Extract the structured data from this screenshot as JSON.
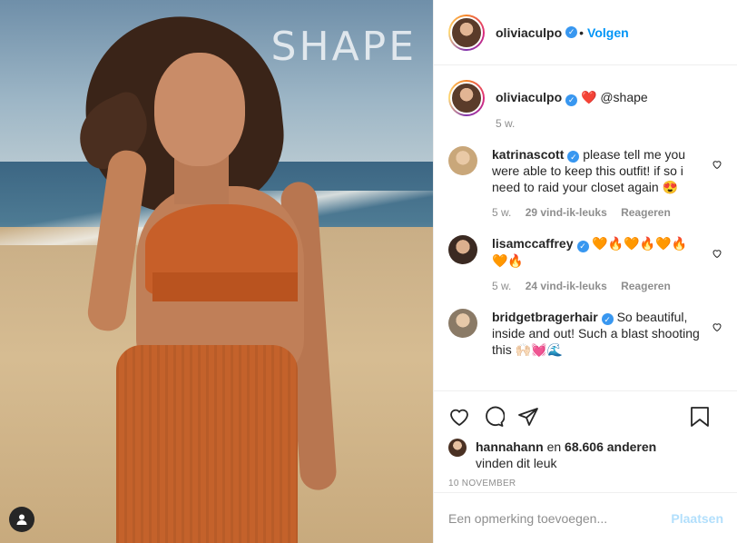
{
  "photo": {
    "overlay_text": "SHAPE"
  },
  "header": {
    "username": "oliviaculpo",
    "separator": "•",
    "follow_label": "Volgen",
    "more_label": "···"
  },
  "caption": {
    "username": "oliviaculpo",
    "text": "❤️ @shape",
    "time": "5 w."
  },
  "comments": [
    {
      "username": "katrinascott",
      "text": "please tell me you were able to keep this outfit! if so i need to raid your closet again 😍",
      "time": "5 w.",
      "likes": "29 vind-ik-leuks",
      "reply": "Reageren"
    },
    {
      "username": "lisamccaffrey",
      "text": "🧡🔥🧡🔥🧡🔥🧡🔥",
      "time": "5 w.",
      "likes": "24 vind-ik-leuks",
      "reply": "Reageren"
    },
    {
      "username": "bridgetbragerhair",
      "text": "So beautiful, inside and out! Such a blast shooting this 🙌🏻💓🌊"
    }
  ],
  "likes": {
    "user": "hannahann",
    "connector": "en",
    "count": "68.606 anderen",
    "suffix": "vinden dit leuk"
  },
  "date": "10 NOVEMBER",
  "add_comment": {
    "placeholder": "Een opmerking toevoegen...",
    "post_label": "Plaatsen"
  },
  "colors": {
    "accent": "#0095f6",
    "verified": "#3897f0",
    "post_disabled": "#b2dffc"
  },
  "icons": [
    "heart-icon",
    "comment-icon",
    "share-icon",
    "bookmark-icon",
    "user-tag-icon",
    "verified-icon"
  ]
}
